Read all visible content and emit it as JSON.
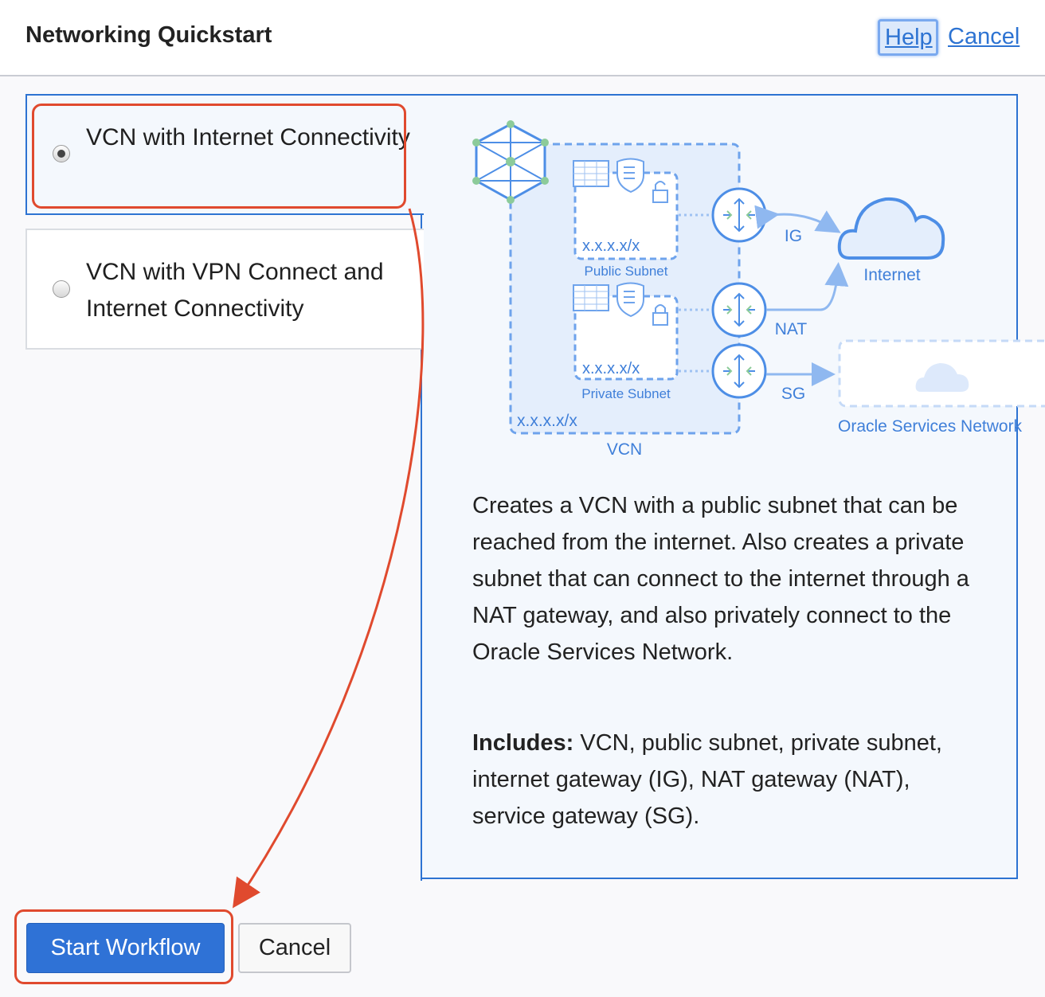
{
  "header": {
    "title": "Networking Quickstart",
    "help_label": "Help",
    "cancel_label": "Cancel"
  },
  "options": [
    {
      "label": "VCN with Internet Connectivity",
      "selected": true
    },
    {
      "label": "VCN with VPN Connect and Internet Connectivity",
      "selected": false
    }
  ],
  "diagram": {
    "public_subnet_cidr": "x.x.x.x/x",
    "public_subnet_label": "Public Subnet",
    "private_subnet_cidr": "x.x.x.x/x",
    "private_subnet_label": "Private Subnet",
    "vcn_cidr": "x.x.x.x/x",
    "vcn_label": "VCN",
    "ig_label": "IG",
    "nat_label": "NAT",
    "sg_label": "SG",
    "internet_label": "Internet",
    "osn_label": "Oracle Services Network"
  },
  "description": "Creates a VCN with a public subnet that can be reached from the internet. Also creates a private subnet that can connect to the internet through a NAT gateway, and also privately connect to the Oracle Services Network.",
  "includes": {
    "label": "Includes:",
    "text": " VCN, public subnet, private subnet, internet gateway (IG), NAT gateway (NAT), service gateway (SG)."
  },
  "footer": {
    "start_label": "Start Workflow",
    "cancel_label": "Cancel"
  },
  "colors": {
    "accent": "#2f72d6",
    "annotation": "#e04a2e",
    "diagram_blue": "#6ea3ec"
  }
}
